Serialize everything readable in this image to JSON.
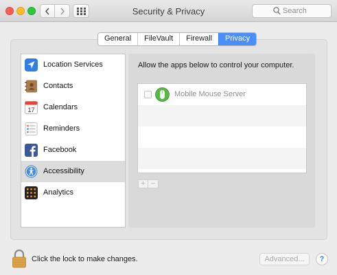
{
  "window": {
    "title": "Security & Privacy"
  },
  "toolbar": {
    "back_icon": "chevron-left-icon",
    "forward_icon": "chevron-right-icon",
    "grid_icon": "grid-icon"
  },
  "search": {
    "placeholder": "Search",
    "icon": "search-icon"
  },
  "tabs": [
    {
      "label": "General",
      "active": false
    },
    {
      "label": "FileVault",
      "active": false
    },
    {
      "label": "Firewall",
      "active": false
    },
    {
      "label": "Privacy",
      "active": true
    }
  ],
  "sidebar": {
    "items": [
      {
        "label": "Location Services",
        "icon": "location-arrow-icon",
        "selected": false
      },
      {
        "label": "Contacts",
        "icon": "contacts-book-icon",
        "selected": false
      },
      {
        "label": "Calendars",
        "icon": "calendar-icon",
        "selected": false
      },
      {
        "label": "Reminders",
        "icon": "reminders-list-icon",
        "selected": false
      },
      {
        "label": "Facebook",
        "icon": "facebook-icon",
        "selected": false
      },
      {
        "label": "Accessibility",
        "icon": "accessibility-icon",
        "selected": true
      },
      {
        "label": "Analytics",
        "icon": "analytics-icon",
        "selected": false
      }
    ],
    "calendar_day": "17"
  },
  "main": {
    "instruction": "Allow the apps below to control your computer.",
    "apps": [
      {
        "name": "Mobile Mouse Server",
        "checked": false,
        "icon": "mobile-mouse-icon"
      }
    ],
    "add_label": "+",
    "remove_label": "−"
  },
  "footer": {
    "lock_text": "Click the lock to make changes.",
    "advanced_label": "Advanced...",
    "help_label": "?"
  },
  "colors": {
    "accent": "#4a8ff9",
    "close": "#fc5f57",
    "minimize": "#fdbc2e",
    "maximize": "#2ac940"
  }
}
